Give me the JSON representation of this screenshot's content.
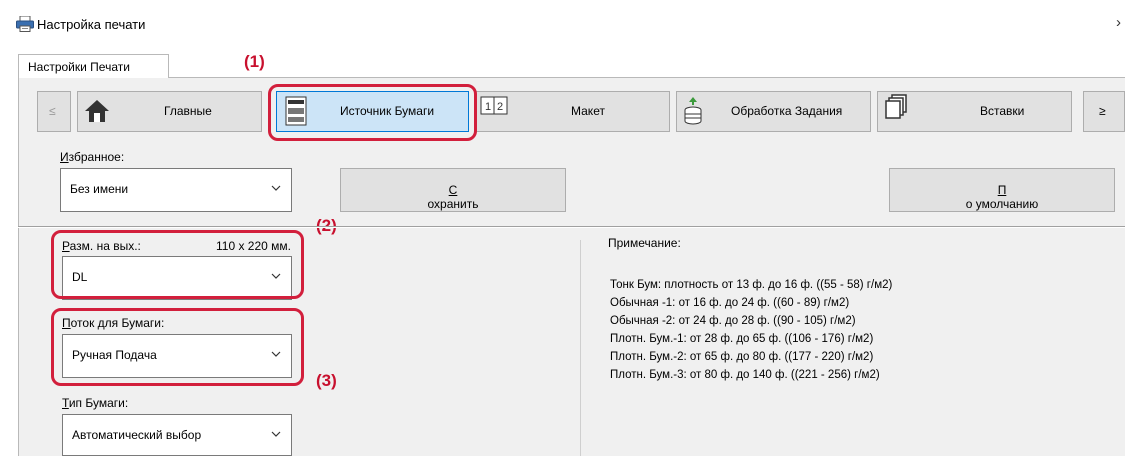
{
  "window": {
    "title": "Настройка печати",
    "close_glyph": "›"
  },
  "tab": {
    "label": "Настройки Печати"
  },
  "callouts": {
    "c1": "(1)",
    "c2": "(2)",
    "c3": "(3)"
  },
  "nav": {
    "prev": "≤",
    "next": "≥",
    "items": [
      {
        "label": "Главные",
        "icon": "home-icon"
      },
      {
        "label": "Источник Бумаги",
        "icon": "paper-source-icon",
        "selected": true
      },
      {
        "label": "Макет",
        "icon": "layout-icon"
      },
      {
        "label": "Обработка Задания",
        "icon": "job-handling-icon"
      },
      {
        "label": "Вставки",
        "icon": "inserts-icon"
      }
    ]
  },
  "favorites": {
    "label_first": "И",
    "label_rest": "збранное:",
    "value": "Без имени",
    "save_first": "С",
    "save_rest": "охранить",
    "default_first": "П",
    "default_rest": "о умолчанию"
  },
  "output_size": {
    "label_first": "Р",
    "label_rest": "азм. на вых.:",
    "dimensions": "110 x 220 мм.",
    "value": "DL"
  },
  "paper_tray": {
    "label_first": "П",
    "label_rest": "оток для Бумаги:",
    "value": "Ручная Подача"
  },
  "paper_type": {
    "label_first": "Т",
    "label_rest": "ип Бумаги:",
    "value": "Автоматический выбор"
  },
  "note": {
    "title": "Примечание:",
    "lines": [
      "Тонк Бум: плотность от 13 ф. до 16 ф. ((55 - 58) г/м2)",
      "Обычная -1: от 16 ф. до 24 ф. ((60 - 89) г/м2)",
      "Обычная -2: от 24 ф. до 28 ф. ((90 - 105) г/м2)",
      "Плотн. Бум.-1: от 28 ф. до 65 ф. ((106 - 176) г/м2)",
      "Плотн. Бум.-2: от 65 ф. до 80 ф. ((177 - 220) г/м2)",
      "Плотн. Бум.-3: от 80 ф. до 140 ф. ((221 - 256) г/м2)"
    ]
  },
  "colors": {
    "highlight": "#d21f3c",
    "selected_bg": "#cce4f7",
    "panel": "#f0f0f0"
  }
}
